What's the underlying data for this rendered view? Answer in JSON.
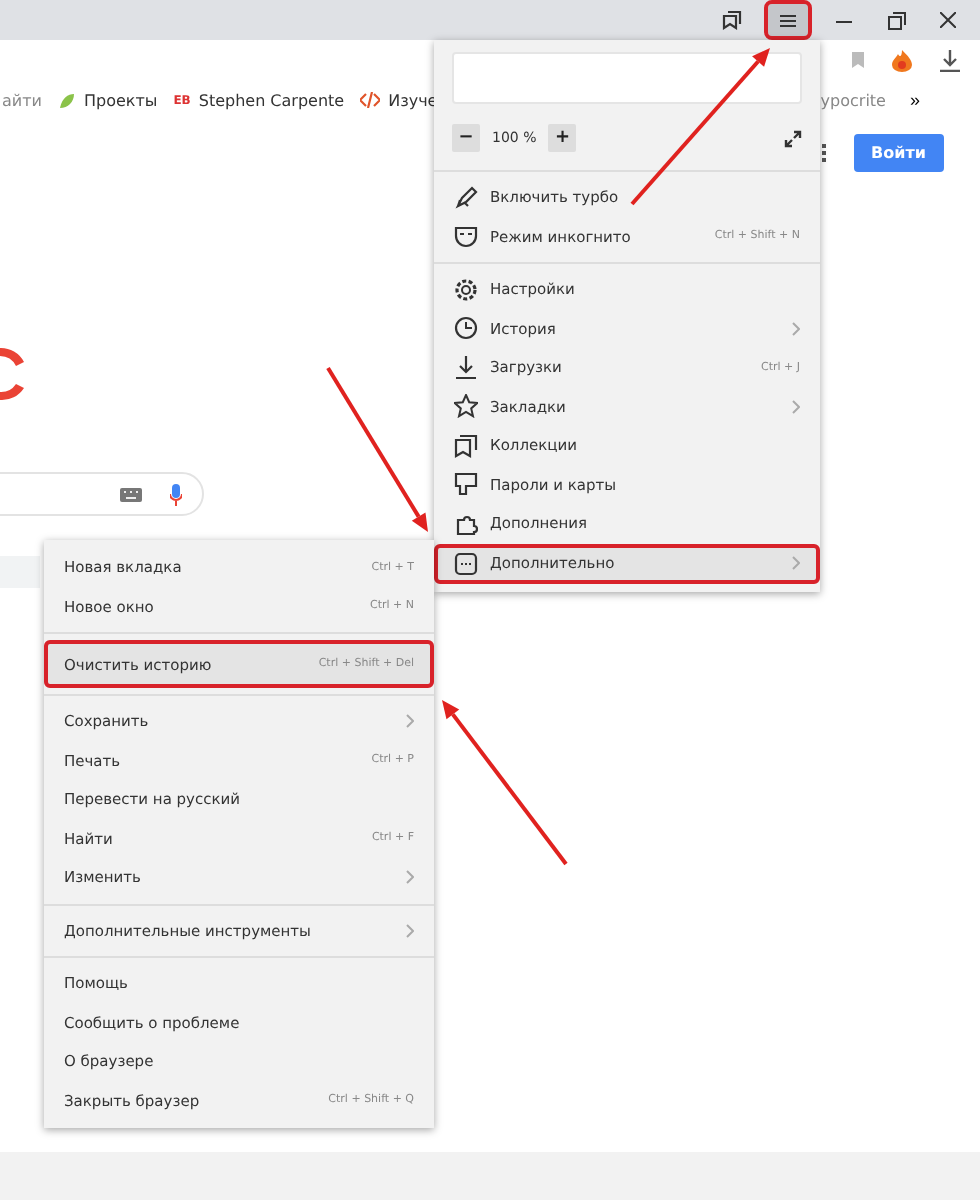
{
  "titlebar": {
    "menu_button": {
      "highlighted": true
    }
  },
  "bookmarks": {
    "left": [
      {
        "label": "айти",
        "faded": true
      },
      {
        "label": "Проекты",
        "faded": false
      },
      {
        "label": "Stephen Carpente",
        "faded": false,
        "badge": "EB"
      },
      {
        "label": "Изуче",
        "faded": false
      }
    ],
    "right": [
      {
        "label": "ypocrite",
        "faded": true
      }
    ],
    "more": "»"
  },
  "page": {
    "sign_in": "Войти"
  },
  "main_menu": {
    "zoom": {
      "minus": "−",
      "value": "100 %",
      "plus": "+"
    },
    "sections": [
      {
        "items": [
          {
            "label": "Включить турбо",
            "highlighted": false,
            "submenu": false
          },
          {
            "label": "Режим инкогнито",
            "shortcut": "Ctrl + Shift + N",
            "highlighted": false,
            "submenu": false
          }
        ]
      },
      {
        "items": [
          {
            "label": "Настройки",
            "highlighted": false,
            "submenu": false
          },
          {
            "label": "История",
            "highlighted": false,
            "submenu": true
          },
          {
            "label": "Загрузки",
            "shortcut": "Ctrl + J",
            "highlighted": false,
            "submenu": false
          },
          {
            "label": "Закладки",
            "highlighted": false,
            "submenu": true
          },
          {
            "label": "Коллекции",
            "highlighted": false,
            "submenu": false
          },
          {
            "label": "Пароли и карты",
            "highlighted": false,
            "submenu": false
          },
          {
            "label": "Дополнения",
            "highlighted": false,
            "submenu": false
          },
          {
            "label": "Дополнительно",
            "highlighted": true,
            "submenu": true
          }
        ]
      }
    ]
  },
  "submenu": {
    "sections": [
      {
        "items": [
          {
            "label": "Новая вкладка",
            "shortcut": "Ctrl + T",
            "highlighted": false,
            "submenu": false
          },
          {
            "label": "Новое окно",
            "shortcut": "Ctrl + N",
            "highlighted": false,
            "submenu": false
          }
        ]
      },
      {
        "items": [
          {
            "label": "Очистить историю",
            "shortcut": "Ctrl + Shift + Del",
            "highlighted": true,
            "submenu": false
          }
        ]
      },
      {
        "items": [
          {
            "label": "Сохранить",
            "highlighted": false,
            "submenu": true
          },
          {
            "label": "Печать",
            "shortcut": "Ctrl + P",
            "highlighted": false,
            "submenu": false
          },
          {
            "label": "Перевести на русский",
            "highlighted": false,
            "submenu": false
          },
          {
            "label": "Найти",
            "shortcut": "Ctrl + F",
            "highlighted": false,
            "submenu": false
          },
          {
            "label": "Изменить",
            "highlighted": false,
            "submenu": true
          }
        ]
      },
      {
        "items": [
          {
            "label": "Дополнительные инструменты",
            "highlighted": false,
            "submenu": true
          }
        ]
      },
      {
        "items": [
          {
            "label": "Помощь",
            "highlighted": false,
            "submenu": false
          },
          {
            "label": "Сообщить о проблеме",
            "highlighted": false,
            "submenu": false
          },
          {
            "label": "О браузере",
            "highlighted": false,
            "submenu": false
          },
          {
            "label": "Закрыть браузер",
            "shortcut": "Ctrl + Shift + Q",
            "highlighted": false,
            "submenu": false
          }
        ]
      }
    ]
  }
}
